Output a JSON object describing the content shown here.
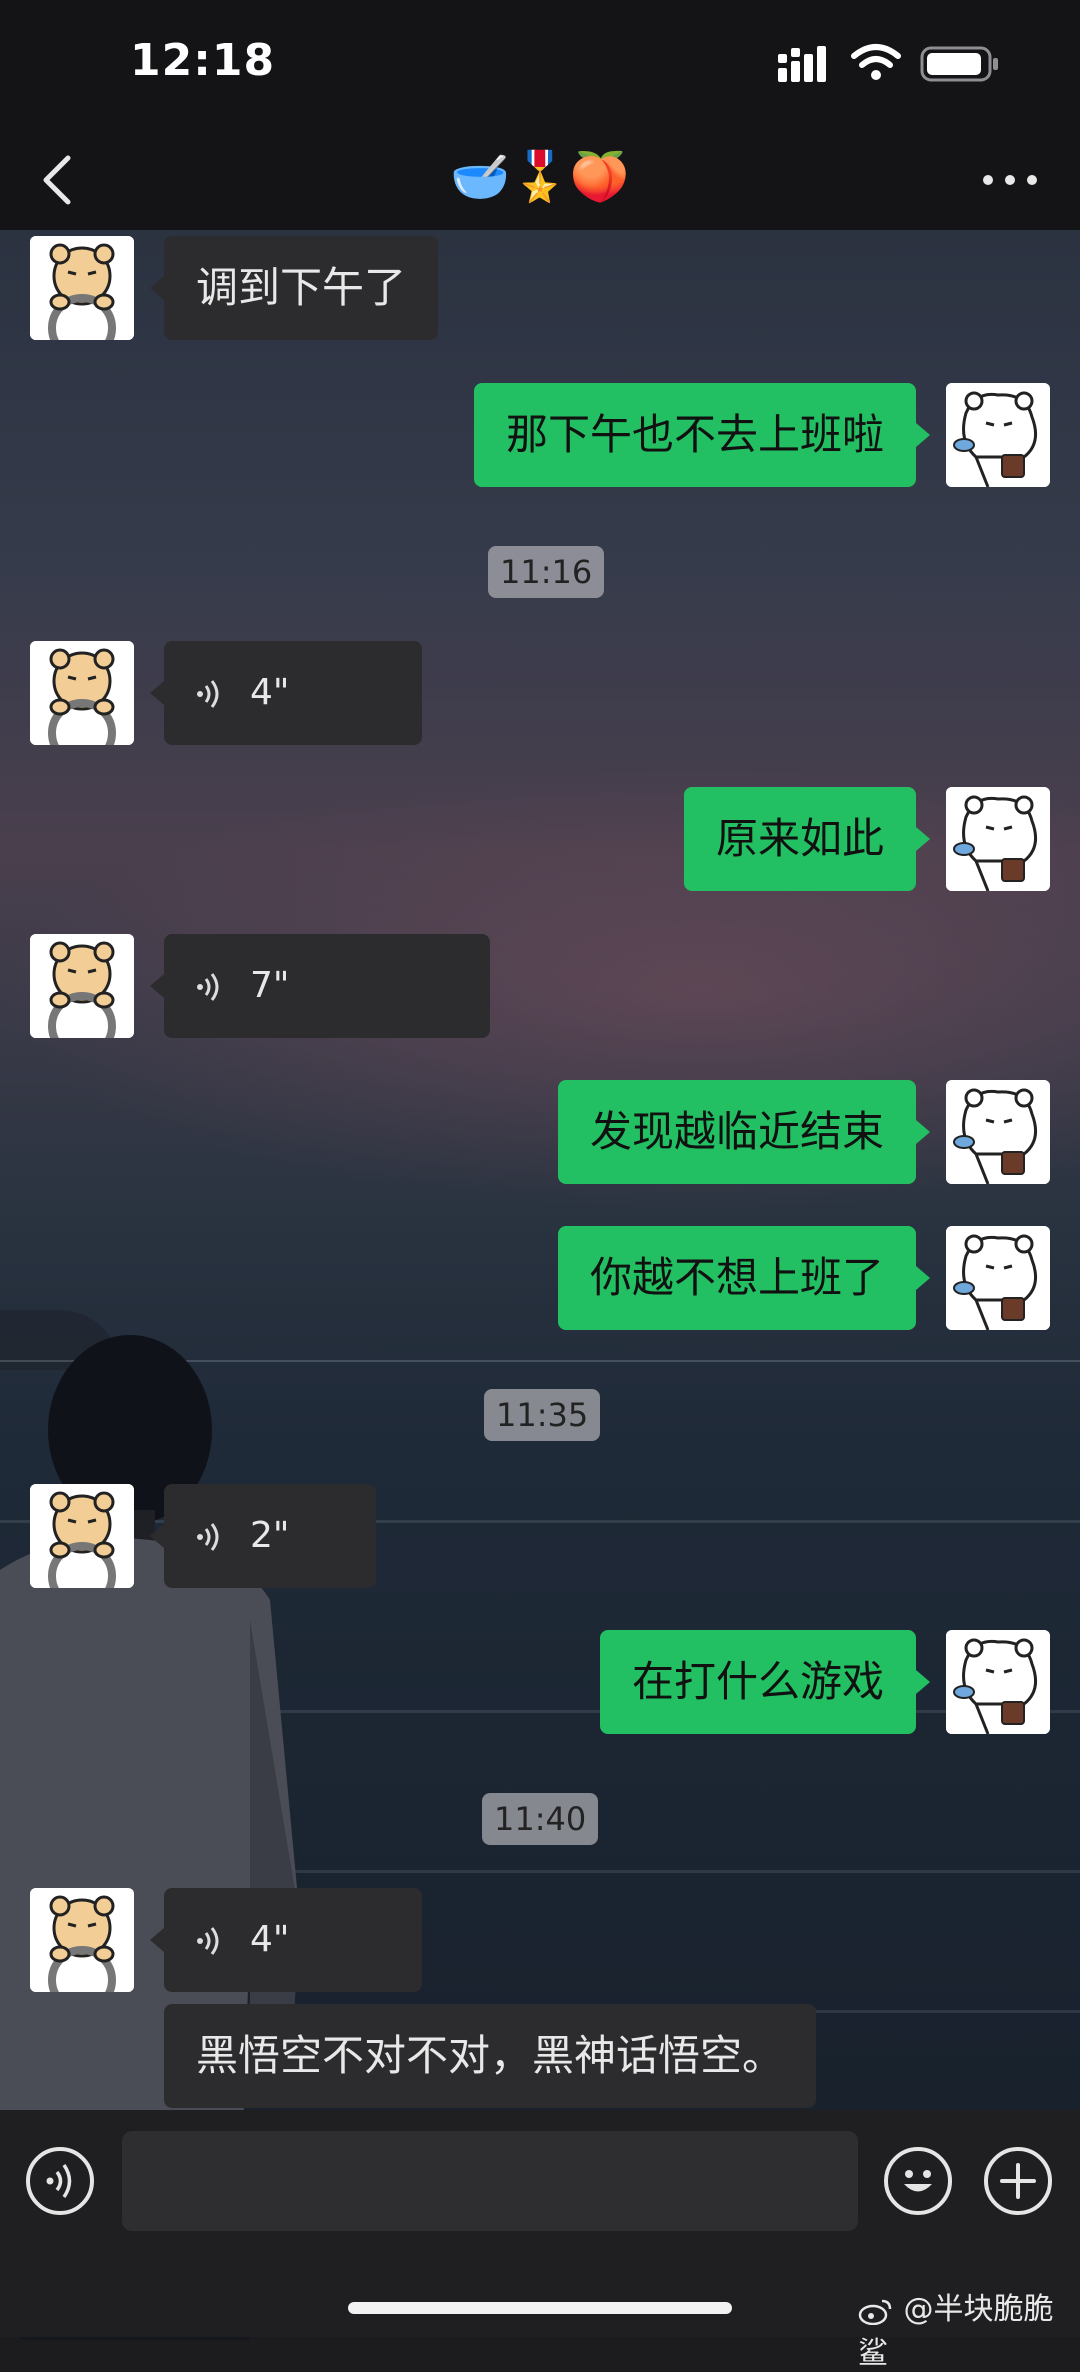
{
  "status_bar": {
    "time": "12:18"
  },
  "nav": {
    "title": "🥣🎖️🍑"
  },
  "messages": [
    {
      "side": "left",
      "type": "text",
      "text": "调到下午了"
    },
    {
      "side": "right",
      "type": "text",
      "text": "那下午也不去上班啦"
    },
    {
      "type": "timestamp",
      "text": "11:16"
    },
    {
      "side": "left",
      "type": "voice",
      "duration": "4\""
    },
    {
      "side": "right",
      "type": "text",
      "text": "原来如此"
    },
    {
      "side": "left",
      "type": "voice",
      "duration": "7\""
    },
    {
      "side": "right",
      "type": "text",
      "text": "发现越临近结束"
    },
    {
      "side": "right",
      "type": "text",
      "text": "你越不想上班了"
    },
    {
      "type": "timestamp",
      "text": "11:35"
    },
    {
      "side": "left",
      "type": "voice",
      "duration": "2\""
    },
    {
      "side": "right",
      "type": "text",
      "text": "在打什么游戏"
    },
    {
      "type": "timestamp",
      "text": "11:40"
    },
    {
      "side": "left",
      "type": "voice",
      "duration": "4\""
    },
    {
      "side": "left",
      "type": "text",
      "text": "黑悟空不对不对，黑神话悟空。"
    }
  ],
  "input_bar": {
    "value": "",
    "placeholder": ""
  },
  "watermark": "@半块脆脆鲨",
  "colors": {
    "outgoing_bubble": "#23c063",
    "incoming_bubble": "#2c2c2e",
    "timestamp_bg": "#a9a9ae"
  }
}
